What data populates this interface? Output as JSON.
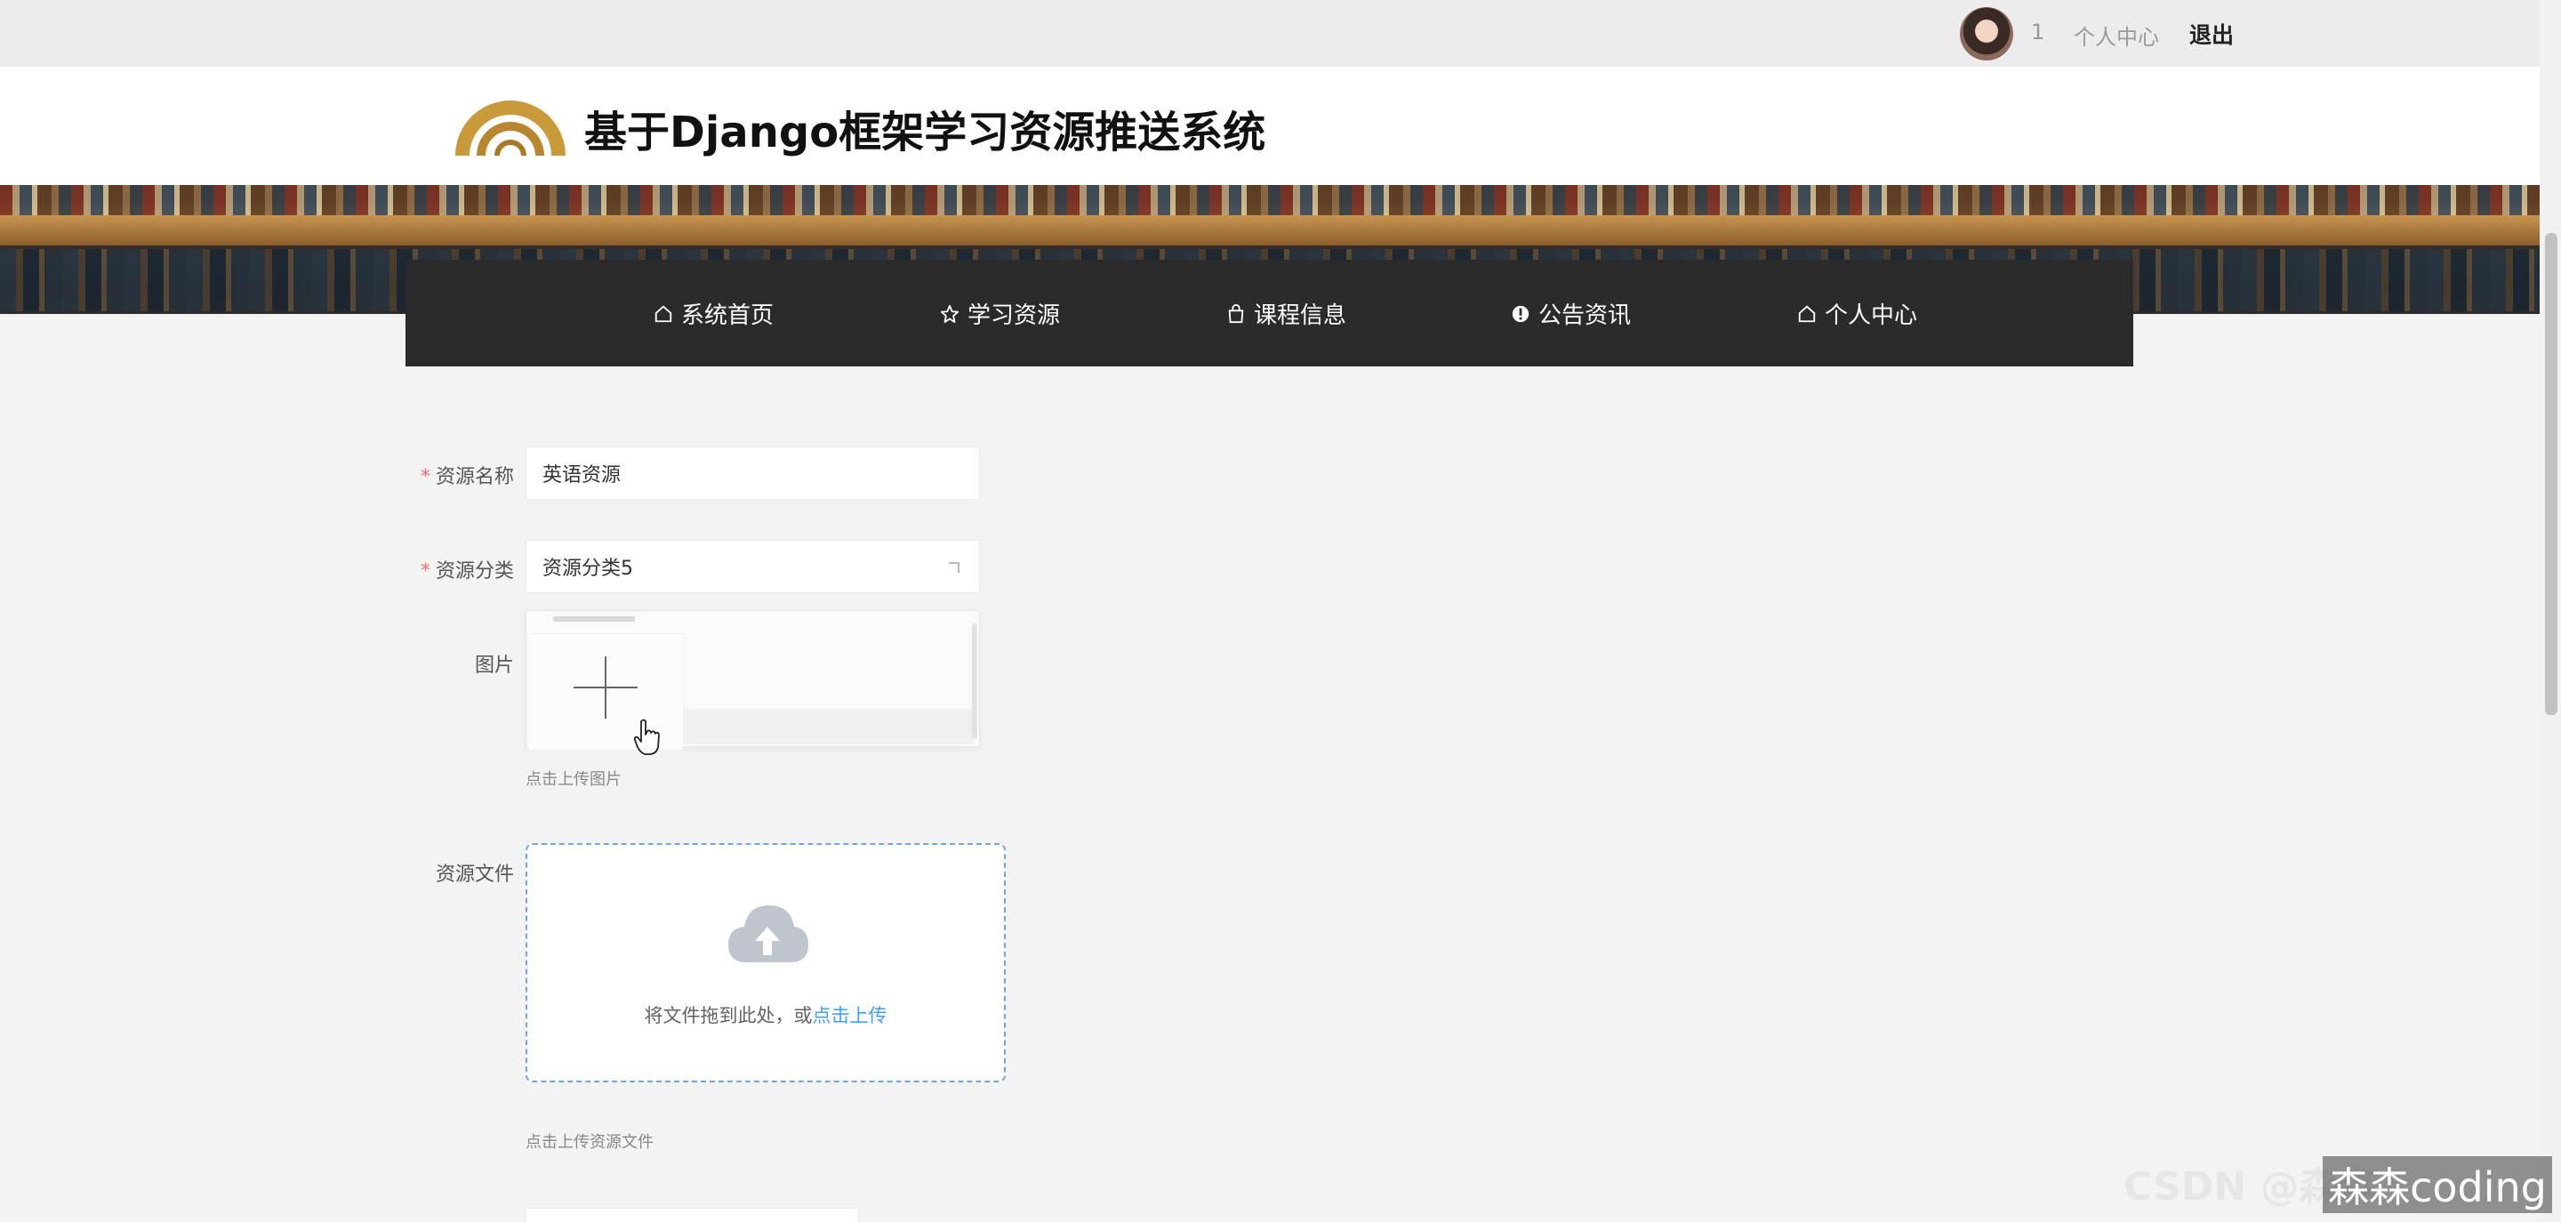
{
  "topbar": {
    "username": "1",
    "personal_center": "个人中心",
    "logout": "退出"
  },
  "header": {
    "title": "基于Django框架学习资源推送系统"
  },
  "nav": {
    "items": [
      {
        "label": "系统首页",
        "icon": "home-icon"
      },
      {
        "label": "学习资源",
        "icon": "star-icon"
      },
      {
        "label": "课程信息",
        "icon": "bag-icon"
      },
      {
        "label": "公告资讯",
        "icon": "info-icon"
      },
      {
        "label": "个人中心",
        "icon": "home-icon"
      }
    ]
  },
  "form": {
    "name_label": "资源名称",
    "name_value": "英语资源",
    "category_label": "资源分类",
    "category_value": "资源分类5",
    "image_label": "图片",
    "image_hint": "点击上传图片",
    "file_label": "资源文件",
    "dropzone_text": "将文件拖到此处，或",
    "dropzone_link": "点击上传",
    "file_hint": "点击上传资源文件"
  },
  "watermark": {
    "text": "森森coding",
    "ghost": "CSDN @森森"
  },
  "colors": {
    "nav_bg": "#2b2b2b",
    "accent": "#409eff",
    "required": "#f56c6c"
  }
}
